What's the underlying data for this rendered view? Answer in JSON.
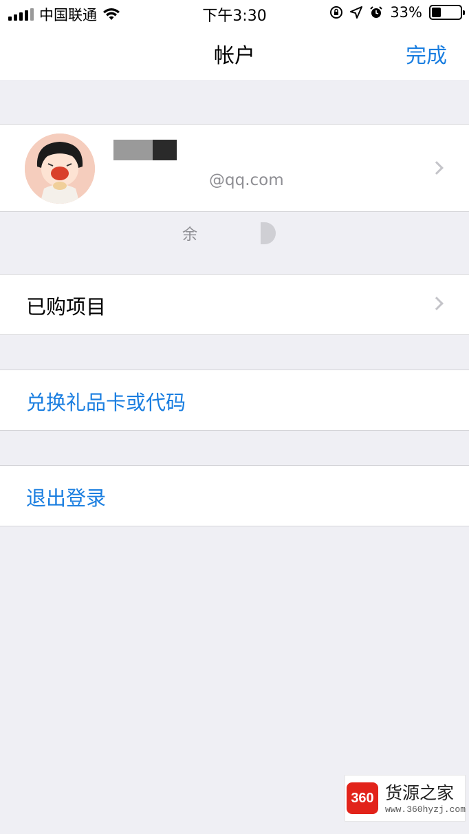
{
  "status_bar": {
    "carrier": "中国联通",
    "time": "下午3:30",
    "battery": "33%",
    "battery_level": 0.33
  },
  "nav": {
    "title": "帐户",
    "done_label": "完成"
  },
  "profile": {
    "email_visible": "@qq.com"
  },
  "balance": {
    "label_visible": "余"
  },
  "menu": {
    "purchased": "已购项目",
    "redeem": "兑换礼品卡或代码",
    "logout": "退出登录"
  },
  "watermark": {
    "logo_text": "360",
    "title": "货源之家",
    "url": "www.360hyzj.com"
  },
  "colors": {
    "accent": "#1a7ee0",
    "background": "#efeff4",
    "watermark_red": "#e2231a"
  }
}
